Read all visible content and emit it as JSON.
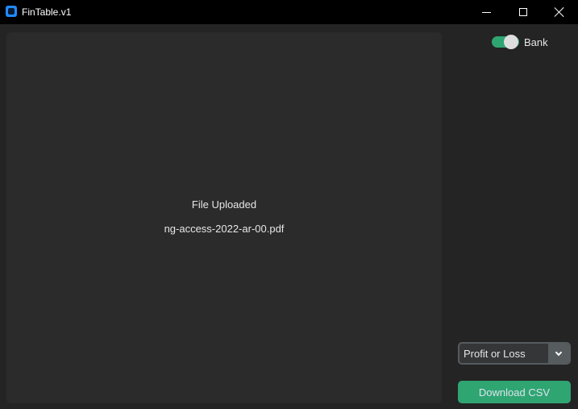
{
  "window": {
    "title": "FinTable.v1",
    "icon": "app-icon",
    "controls": [
      "minimize-icon",
      "maximize-icon",
      "close-icon"
    ]
  },
  "main": {
    "status_text": "File Uploaded",
    "file_name": "ng-access-2022-ar-00.pdf"
  },
  "sidebar": {
    "bank_toggle": {
      "label": "Bank",
      "checked": true
    },
    "report_select": {
      "value": "Profit or Loss"
    },
    "download_button": {
      "label": "Download CSV"
    }
  },
  "colors": {
    "background": "#242424",
    "panel": "#2b2b2b",
    "titlebar": "#000000",
    "accent": "#2fa572",
    "select_border": "#565b5e"
  }
}
